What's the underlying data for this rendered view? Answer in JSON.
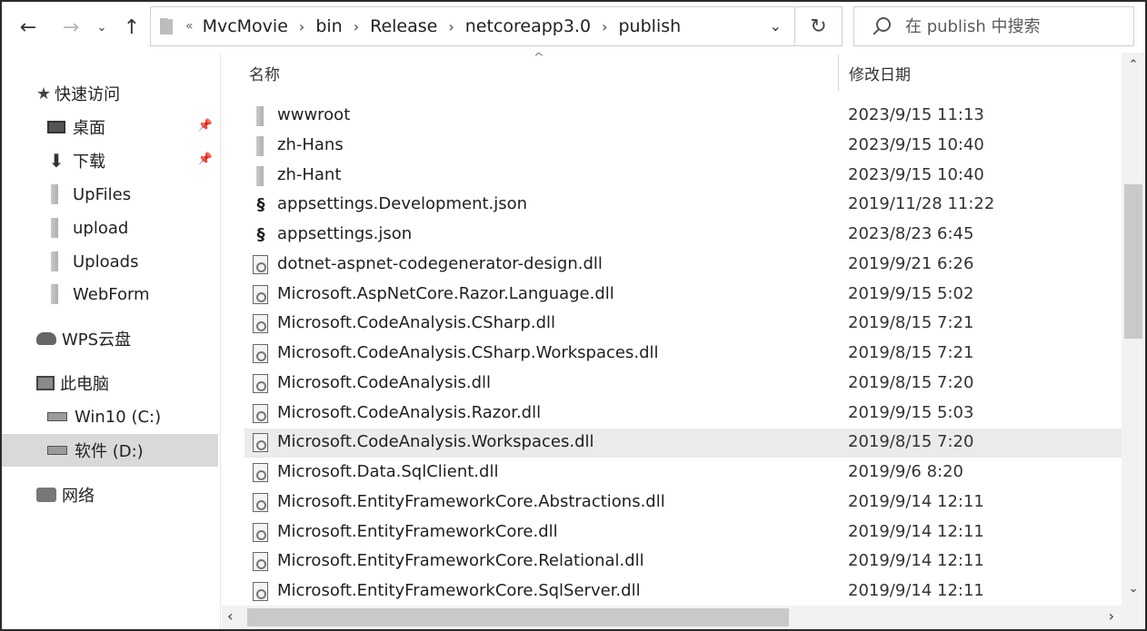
{
  "address": {
    "more": "«",
    "crumbs": [
      "MvcMovie",
      "bin",
      "Release",
      "netcoreapp3.0",
      "publish"
    ]
  },
  "search": {
    "placeholder": "在 publish 中搜索"
  },
  "nav": {
    "quick_access": "快速访问",
    "desktop": "桌面",
    "downloads": "下载",
    "upfiles": "UpFiles",
    "upload": "upload",
    "uploads": "Uploads",
    "webform": "WebForm",
    "wps": "WPS云盘",
    "this_pc": "此电脑",
    "drive_c": "Win10 (C:)",
    "drive_d": "软件 (D:)",
    "network": "网络"
  },
  "columns": {
    "name": "名称",
    "modified": "修改日期"
  },
  "files": [
    {
      "name": "wwwroot",
      "date": "2023/9/15 11:13",
      "type": "folder"
    },
    {
      "name": "zh-Hans",
      "date": "2023/9/15 10:40",
      "type": "folder"
    },
    {
      "name": "zh-Hant",
      "date": "2023/9/15 10:40",
      "type": "folder"
    },
    {
      "name": "appsettings.Development.json",
      "date": "2019/11/28 11:22",
      "type": "json"
    },
    {
      "name": "appsettings.json",
      "date": "2023/8/23 6:45",
      "type": "json"
    },
    {
      "name": "dotnet-aspnet-codegenerator-design.dll",
      "date": "2019/9/21 6:26",
      "type": "dll"
    },
    {
      "name": "Microsoft.AspNetCore.Razor.Language.dll",
      "date": "2019/9/15 5:02",
      "type": "dll"
    },
    {
      "name": "Microsoft.CodeAnalysis.CSharp.dll",
      "date": "2019/8/15 7:21",
      "type": "dll"
    },
    {
      "name": "Microsoft.CodeAnalysis.CSharp.Workspaces.dll",
      "date": "2019/8/15 7:21",
      "type": "dll"
    },
    {
      "name": "Microsoft.CodeAnalysis.dll",
      "date": "2019/8/15 7:20",
      "type": "dll"
    },
    {
      "name": "Microsoft.CodeAnalysis.Razor.dll",
      "date": "2019/9/15 5:03",
      "type": "dll"
    },
    {
      "name": "Microsoft.CodeAnalysis.Workspaces.dll",
      "date": "2019/8/15 7:20",
      "type": "dll"
    },
    {
      "name": "Microsoft.Data.SqlClient.dll",
      "date": "2019/9/6 8:20",
      "type": "dll"
    },
    {
      "name": "Microsoft.EntityFrameworkCore.Abstractions.dll",
      "date": "2019/9/14 12:11",
      "type": "dll"
    },
    {
      "name": "Microsoft.EntityFrameworkCore.dll",
      "date": "2019/9/14 12:11",
      "type": "dll"
    },
    {
      "name": "Microsoft.EntityFrameworkCore.Relational.dll",
      "date": "2019/9/14 12:11",
      "type": "dll"
    },
    {
      "name": "Microsoft.EntityFrameworkCore.SqlServer.dll",
      "date": "2019/9/14 12:11",
      "type": "dll"
    }
  ]
}
